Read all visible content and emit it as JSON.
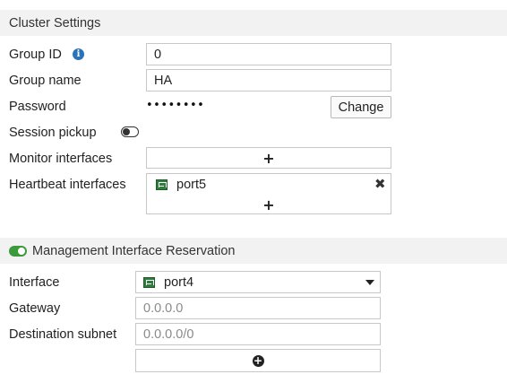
{
  "cluster": {
    "title": "Cluster Settings",
    "group_id_label": "Group ID",
    "group_id_value": "0",
    "group_name_label": "Group name",
    "group_name_value": "HA",
    "password_label": "Password",
    "password_value": "••••••••",
    "change_label": "Change",
    "session_pickup_label": "Session pickup",
    "session_pickup_enabled": false,
    "monitor_label": "Monitor interfaces",
    "monitor_add": "+",
    "heartbeat_label": "Heartbeat interfaces",
    "heartbeat_items": [
      "port5"
    ],
    "heartbeat_add": "+"
  },
  "management": {
    "title": "Management Interface Reservation",
    "enabled": true,
    "interface_label": "Interface",
    "interface_value": "port4",
    "gateway_label": "Gateway",
    "gateway_placeholder": "0.0.0.0",
    "dest_label": "Destination subnet",
    "dest_placeholder": "0.0.0.0/0",
    "add_symbol": "+"
  },
  "icons": {
    "info": "info-icon",
    "toggle": "toggle-icon",
    "port": "port-icon",
    "close": "close-icon",
    "dropdown": "chevron-down-icon",
    "add": "plus-icon",
    "add_circle": "plus-circle-icon"
  },
  "colors": {
    "header_bg": "#f2f2f2",
    "toggle_on": "#3c9a3c",
    "info_blue": "#2a73b8",
    "port_green": "#2f7d3c"
  }
}
